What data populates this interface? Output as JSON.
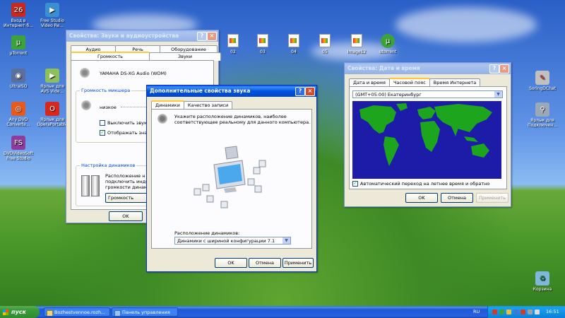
{
  "desktop": {
    "left_icons": [
      {
        "label": "Вход в Интернет-б...",
        "color": "#c8281e",
        "glyph": "26"
      },
      {
        "label": "Free Studio Video Re...",
        "color": "#3a8fd0",
        "glyph": "▶"
      },
      {
        "label": "µTorrent",
        "color": "#3ca23a",
        "glyph": "µ"
      },
      {
        "label": "UltraISO",
        "color": "#5a6f9e",
        "glyph": "◉"
      },
      {
        "label": "Ярлык для AVS Vide...",
        "color": "#8cc05a",
        "glyph": "▶"
      },
      {
        "label": "Any DVD Converte...",
        "color": "#e65a1e",
        "glyph": "◎"
      },
      {
        "label": "Ярлык для OperaPortable",
        "color": "#d8281e",
        "glyph": "O"
      },
      {
        "label": "DVDVideoSoft Free Studio",
        "color": "#8c3c9e",
        "glyph": "FS"
      }
    ],
    "file_icons": [
      {
        "label": "02"
      },
      {
        "label": "03"
      },
      {
        "label": "04"
      },
      {
        "label": "05"
      },
      {
        "label": "Image12"
      }
    ],
    "utorrent_top": {
      "label": "utorrent"
    },
    "right_icons": [
      {
        "label": "SoringDChat",
        "glyph": "✎"
      },
      {
        "label": "Ярлык для Подключен...",
        "glyph": "⚲"
      },
      {
        "label": "Корзина",
        "glyph": "♻"
      }
    ]
  },
  "sound_window": {
    "title": "Свойства: Звуки и аудиоустройства",
    "tabs_row1": [
      "Аудио",
      "Речь",
      "Оборудование"
    ],
    "tabs_row2": [
      "Громкость",
      "Звуки"
    ],
    "device": "YAMAHA DS-XG Audio (WDM)",
    "mixer_group": "Громкость микшера",
    "low_label": "низкое",
    "mute_label": "Выключить звук",
    "tray_label": "Отображать значок",
    "speakers_group": "Настройка динамиков",
    "speakers_text": [
      "Расположение н",
      "подключить инди",
      "громкости динам"
    ],
    "speakers_button": "Громкость динами",
    "ok": "OK"
  },
  "adv_window": {
    "title": "Дополнительные свойства звука",
    "tabs": [
      "Динамики",
      "Качество записи"
    ],
    "description": [
      "Укажите расположение динамиков, наиболее",
      "соответствующее реальному для данного компьютера."
    ],
    "placement_label": "Расположение динамиков:",
    "placement_value": "Динамики с шириной конфигурации 7.1",
    "ok": "OK",
    "cancel": "Отмена",
    "apply": "Применить"
  },
  "datetime_window": {
    "title": "Свойства: Дата и время",
    "tabs": [
      "Дата и время",
      "Часовой пояс",
      "Время Интернета"
    ],
    "timezone": "(GMT+05:00) Екатеринбург",
    "dst_label": "Автоматический переход на летнее время и обратно",
    "ok": "OK",
    "cancel": "Отмена",
    "apply": "Применить"
  },
  "taskbar": {
    "start": "пуск",
    "items": [
      "Bozhestvennoe.rozh...",
      "Панель управления"
    ],
    "lang": "RU",
    "clock": "16:51"
  },
  "colors": {
    "map_ocean": "#1c1ca8",
    "map_land": "#1ea51e",
    "accent_title": "#0052e0"
  }
}
